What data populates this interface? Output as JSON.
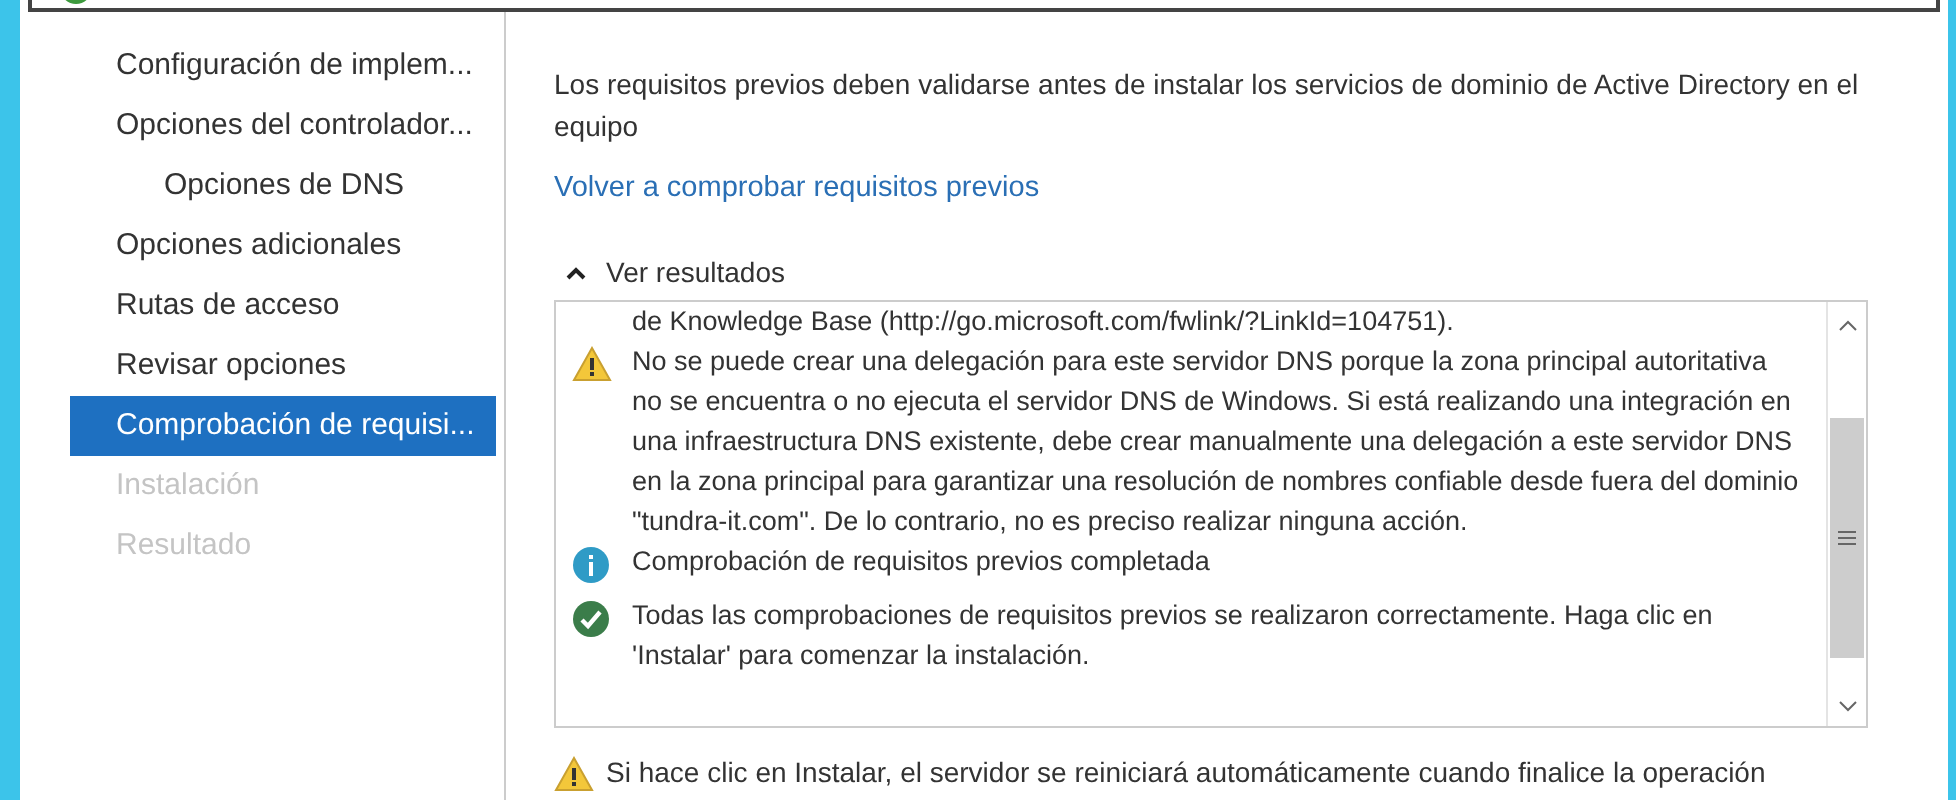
{
  "sidebar": {
    "items": [
      {
        "label": "Configuración de implem...",
        "disabled": false,
        "selected": false
      },
      {
        "label": "Opciones del controlador...",
        "disabled": false,
        "selected": false,
        "children": [
          {
            "label": "Opciones de DNS",
            "disabled": false,
            "selected": false
          }
        ]
      },
      {
        "label": "Opciones adicionales",
        "disabled": false,
        "selected": false
      },
      {
        "label": "Rutas de acceso",
        "disabled": false,
        "selected": false
      },
      {
        "label": "Revisar opciones",
        "disabled": false,
        "selected": false
      },
      {
        "label": "Comprobación de requisi...",
        "disabled": false,
        "selected": true
      },
      {
        "label": "Instalación",
        "disabled": true,
        "selected": false
      },
      {
        "label": "Resultado",
        "disabled": true,
        "selected": false
      }
    ]
  },
  "content": {
    "intro": "Los requisitos previos deben validarse antes de instalar los servicios de dominio de Active Directory en el equipo",
    "recheck_link": "Volver a comprobar requisitos previos",
    "results": {
      "toggle": "Ver resultados",
      "expanded": true,
      "entries": [
        {
          "kind": "text",
          "text": "de Knowledge Base (http://go.microsoft.com/fwlink/?LinkId=104751)."
        },
        {
          "kind": "warning",
          "text": "No se puede crear una delegación para este servidor DNS porque la zona principal autoritativa no se encuentra o no ejecuta el servidor DNS de Windows. Si está realizando una integración en una infraestructura DNS existente, debe crear manualmente una delegación a este servidor DNS en la zona principal para garantizar una resolución de nombres confiable desde fuera del dominio \"tundra-it.com\". De lo contrario, no es preciso realizar ninguna acción."
        },
        {
          "kind": "info",
          "text": "Comprobación de requisitos previos completada"
        },
        {
          "kind": "success",
          "text": "Todas las comprobaciones de requisitos previos se realizaron correctamente. Haga clic en 'Instalar' para comenzar la instalación."
        }
      ]
    },
    "footer_warning": "Si hace clic en Instalar, el servidor se reiniciará automáticamente cuando finalice la operación"
  }
}
